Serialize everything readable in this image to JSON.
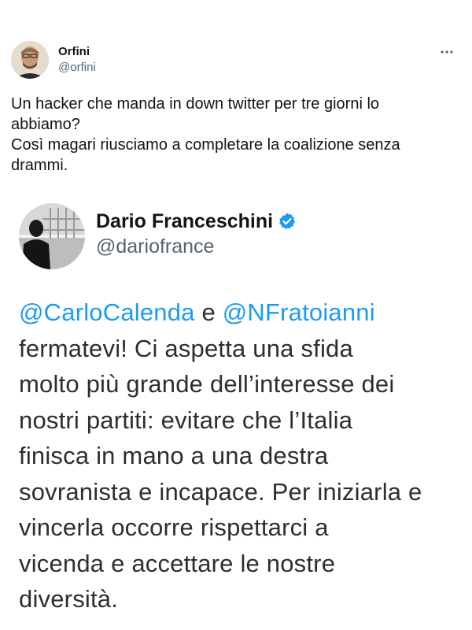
{
  "outer_tweet": {
    "display_name": "Orfini",
    "handle": "@orfini",
    "more_icon": "more-horizontal-icon",
    "text_lines": [
      "Un hacker che manda in down twitter per tre giorni lo",
      "abbiamo?",
      "Così magari riusciamo a completare la coalizione senza",
      "drammi."
    ]
  },
  "quoted_tweet": {
    "display_name": "Dario Franceschini",
    "handle": "@dariofrance",
    "verified_icon": "verified-badge-icon",
    "mention_1": "@CarloCalenda",
    "connector": " e ",
    "mention_2": "@NFratoianni",
    "text_lines": [
      "fermatevi! Ci aspetta una sfida",
      "molto più grande dell’interesse dei",
      "nostri partiti: evitare che l’Italia",
      "finisca in mano a una destra",
      "sovranista e incapace. Per iniziarla e",
      "vincerla occorre rispettarci a",
      "vicenda e accettare le nostre",
      "diversità."
    ]
  },
  "colors": {
    "mention": "#1d9bf0",
    "verified": "#1d9bf0",
    "secondary_text": "#536471",
    "primary_text": "#0f1419"
  }
}
